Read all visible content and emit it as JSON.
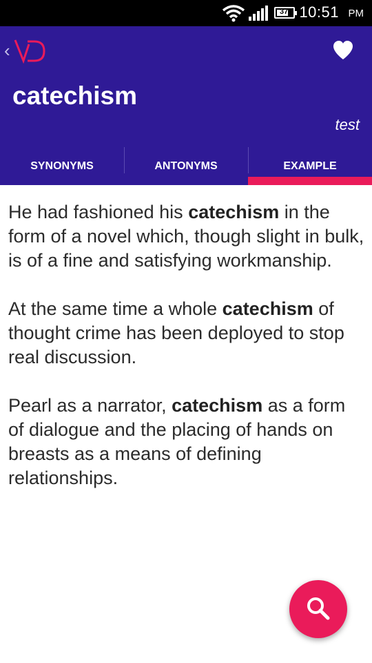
{
  "status_bar": {
    "time": "10:51",
    "ampm": "PM",
    "battery_level": "37"
  },
  "header": {
    "back_icon": "chevron-left-icon",
    "logo": "VD",
    "favorite_icon": "heart-icon",
    "word": "catechism",
    "tag": "test"
  },
  "tabs": [
    {
      "label": "SYNONYMS",
      "selected": false
    },
    {
      "label": "ANTONYMS",
      "selected": false
    },
    {
      "label": "EXAMPLE",
      "selected": true
    }
  ],
  "examples": [
    {
      "before": "He had fashioned his ",
      "highlight": "catechism",
      "after": " in the form of a novel which, though slight in bulk, is of a fine and satisfying workmanship."
    },
    {
      "before": "At the same time a whole ",
      "highlight": "catechism",
      "after": " of thought crime has been deployed to stop real discussion."
    },
    {
      "before": "Pearl as a narrator, ",
      "highlight": "catechism",
      "after": " as a form of dialogue and the placing of hands on breasts as a means of defining relationships."
    }
  ],
  "fab": {
    "icon": "search-icon"
  },
  "colors": {
    "appbar": "#2f1a96",
    "accent": "#ea1b5a",
    "text": "#2b2b2b"
  }
}
